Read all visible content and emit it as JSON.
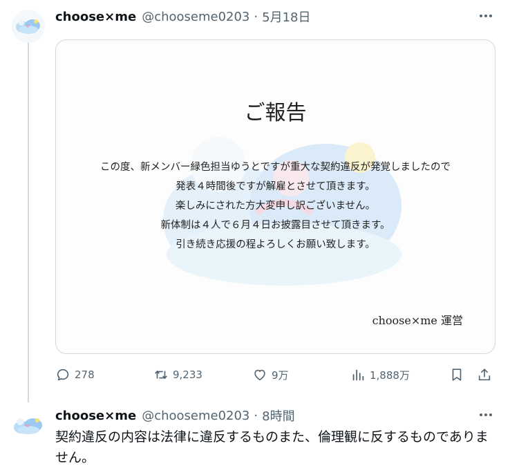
{
  "tweet": {
    "display_name": "choose×me",
    "handle": "@chooseme0203",
    "separator": "·",
    "date": "5月18日",
    "media": {
      "title": "ご報告",
      "lines": [
        "この度、新メンバー緑色担当ゆうとですが重大な契約違反が発覚しましたので",
        "発表４時間後ですが解雇とさせて頂きます。",
        "楽しみにされた方大変申し訳ございません。",
        "新体制は４人で６月４日お披露目させて頂きます。",
        "引き続き応援の程よろしくお願い致します。"
      ],
      "signature": "choose×me 運営"
    },
    "actions": {
      "replies": "278",
      "retweets": "9,233",
      "likes": "9万",
      "views": "1,888万"
    }
  },
  "reply": {
    "display_name": "choose×me",
    "handle": "@chooseme0203",
    "separator": "·",
    "time": "8時間",
    "text": "契約違反の内容は法律に違反するものまた、倫理観に反するものでありません。"
  },
  "icons": {
    "more": "more-icon",
    "reply": "reply-icon",
    "retweet": "retweet-icon",
    "like": "heart-icon",
    "views": "views-icon",
    "bookmark": "bookmark-icon",
    "share": "share-icon"
  },
  "colors": {
    "text": "#0f1419",
    "muted": "#536471",
    "border": "#cfd9de",
    "logo_blue": "#9cc9f0"
  }
}
